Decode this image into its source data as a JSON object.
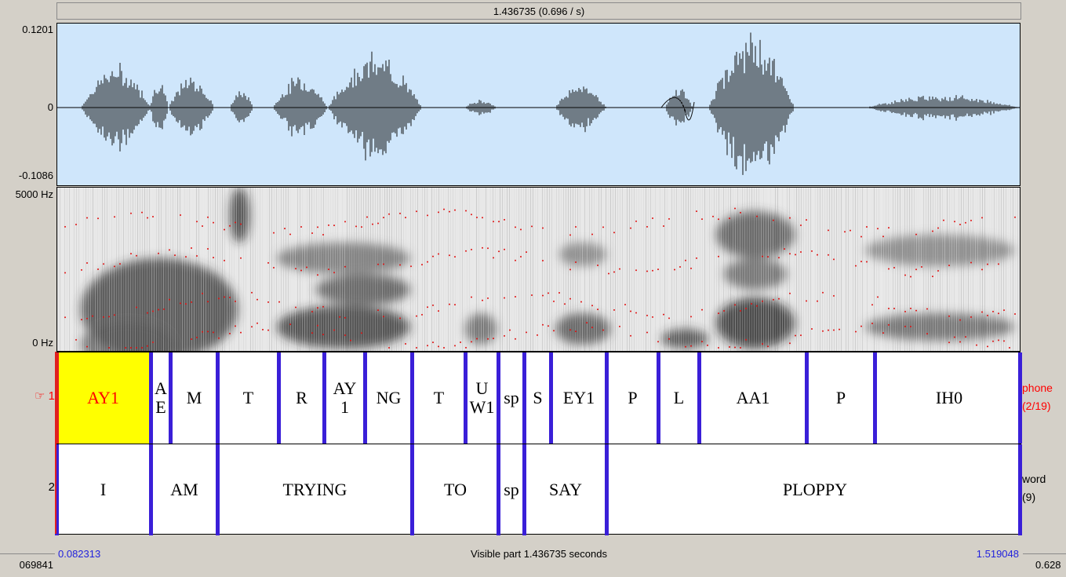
{
  "top_bar": {
    "label": "1.436735 (0.696 / s)"
  },
  "waveform": {
    "max_label": "0.1201",
    "zero_label": "0",
    "min_label": "-0.1086"
  },
  "spectrogram": {
    "top_label": "5000 Hz",
    "bottom_label": "0 Hz"
  },
  "tiers": [
    {
      "number_label": "☞ 1",
      "name": "phone",
      "count": "(2/19)",
      "segments": [
        {
          "text": "AY1",
          "selected": true
        },
        {
          "text": "A E"
        },
        {
          "text": "M"
        },
        {
          "text": "T"
        },
        {
          "text": "R"
        },
        {
          "text": "AY 1"
        },
        {
          "text": "NG"
        },
        {
          "text": "T"
        },
        {
          "text": "U W1"
        },
        {
          "text": "sp"
        },
        {
          "text": "S"
        },
        {
          "text": "EY1"
        },
        {
          "text": "P"
        },
        {
          "text": "L"
        },
        {
          "text": "AA1"
        },
        {
          "text": "P"
        },
        {
          "text": "IH0"
        }
      ]
    },
    {
      "number_label": "2",
      "name": "word",
      "count": "(9)",
      "segments": [
        {
          "text": "I"
        },
        {
          "text": "AM"
        },
        {
          "text": "TRYING"
        },
        {
          "text": "TO"
        },
        {
          "text": "sp"
        },
        {
          "text": "SAY"
        },
        {
          "text": "PLOPPY"
        }
      ]
    }
  ],
  "bottom_bar": {
    "start_time": "0.082313",
    "visible_part": "Visible part 1.436735 seconds",
    "end_time": "1.519048",
    "left_total": "069841",
    "right_total": "0.628"
  },
  "colors": {
    "waveform_bg": "#cfe6fb",
    "boundary": "#3a1fd8",
    "selection": "#ffff00",
    "selected_text": "#ff0000",
    "time_text": "#2222dd"
  }
}
